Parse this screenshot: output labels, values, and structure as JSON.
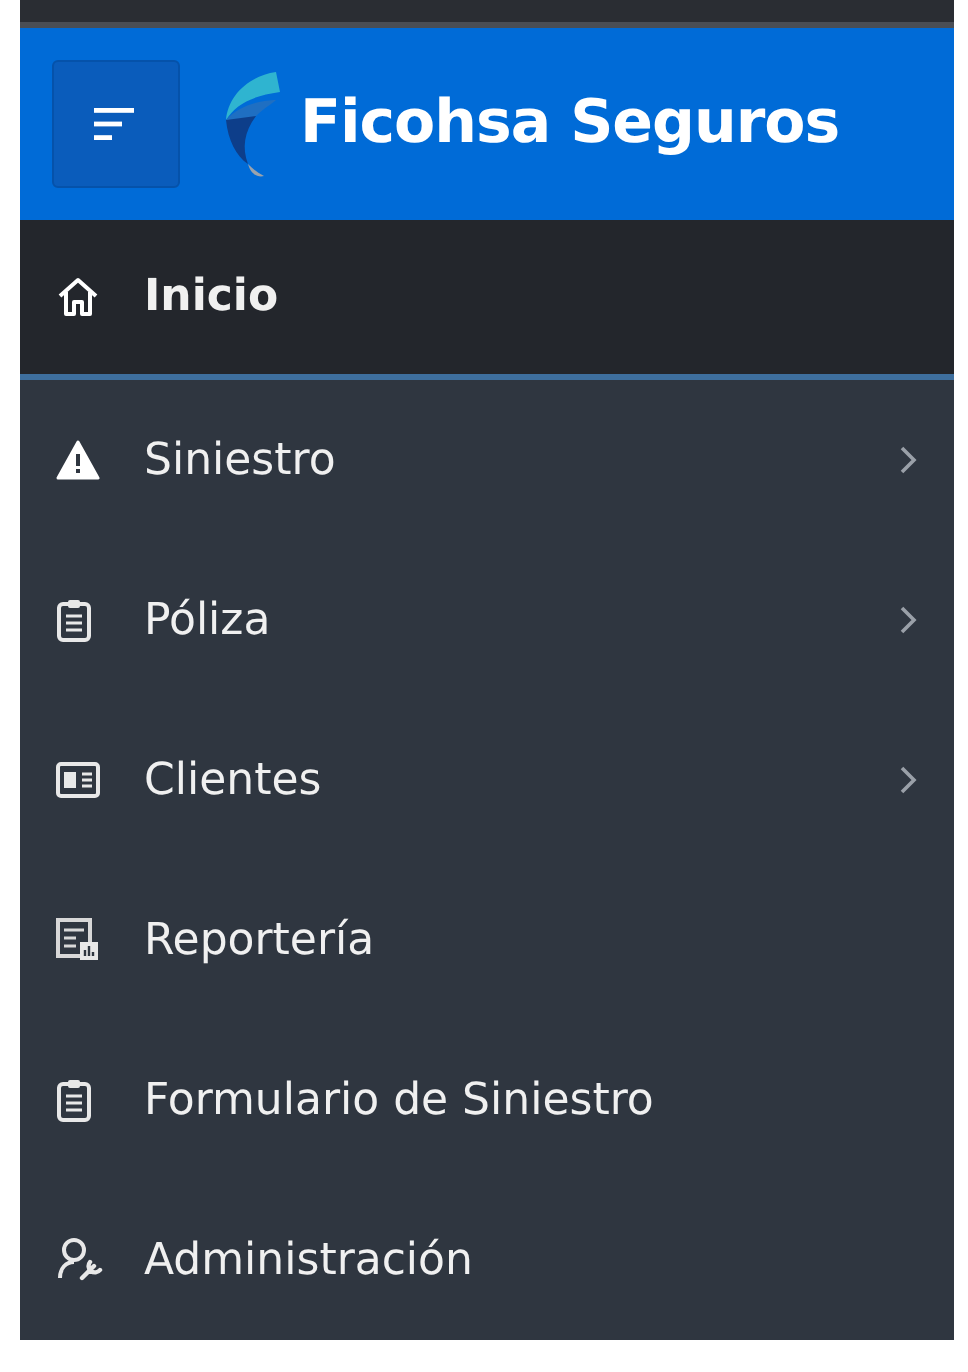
{
  "header": {
    "brand": "Ficohsa Seguros"
  },
  "nav": [
    {
      "label": "Inicio",
      "selected": true,
      "expandable": false
    },
    {
      "label": "Siniestro",
      "selected": false,
      "expandable": true
    },
    {
      "label": "Póliza",
      "selected": false,
      "expandable": true
    },
    {
      "label": "Clientes",
      "selected": false,
      "expandable": true
    },
    {
      "label": "Reportería",
      "selected": false,
      "expandable": false
    },
    {
      "label": "Formulario de Siniestro",
      "selected": false,
      "expandable": false
    },
    {
      "label": "Administración",
      "selected": false,
      "expandable": false
    }
  ]
}
